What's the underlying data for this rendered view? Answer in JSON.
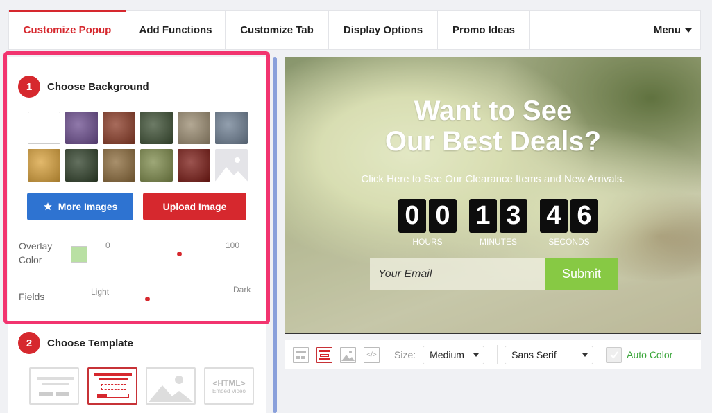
{
  "tabs": [
    {
      "label": "Customize Popup",
      "active": true
    },
    {
      "label": "Add Functions",
      "active": false
    },
    {
      "label": "Customize Tab",
      "active": false
    },
    {
      "label": "Display Options",
      "active": false
    },
    {
      "label": "Promo Ideas",
      "active": false
    }
  ],
  "menu_label": "Menu",
  "step1": {
    "number": "1",
    "title": "Choose Background"
  },
  "background_thumbnails": [
    {
      "name": "blank",
      "color": "#ffffff"
    },
    {
      "name": "purple-flowers",
      "color": "#6b4c8e"
    },
    {
      "name": "red-castle",
      "color": "#8a3a25"
    },
    {
      "name": "forest-path",
      "color": "#3c4f33"
    },
    {
      "name": "cat",
      "color": "#9a8b70"
    },
    {
      "name": "pier",
      "color": "#6e7f93"
    },
    {
      "name": "sunset-yoga",
      "color": "#d9a13a"
    },
    {
      "name": "snowdrops",
      "color": "#2f4029"
    },
    {
      "name": "family-autumn",
      "color": "#8b6a3a"
    },
    {
      "name": "deer",
      "color": "#7d8a4a"
    },
    {
      "name": "red-light",
      "color": "#7a1a14"
    },
    {
      "name": "placeholder",
      "color": "#e4e4e8"
    }
  ],
  "buttons": {
    "more_images": "More Images",
    "upload_image": "Upload Image"
  },
  "overlay": {
    "label_line1": "Overlay",
    "label_line2": "Color",
    "min_label": "0",
    "max_label": "100",
    "swatch_color": "#b9e0a3",
    "value": 50
  },
  "fields": {
    "label": "Fields",
    "light_label": "Light",
    "dark_label": "Dark",
    "value": 35
  },
  "step2": {
    "number": "2",
    "title": "Choose Template"
  },
  "templates": [
    {
      "name": "template-basic",
      "selected": false
    },
    {
      "name": "template-countdown",
      "selected": true
    },
    {
      "name": "template-image",
      "selected": false
    },
    {
      "name": "template-html",
      "selected": false,
      "html_label": "<HTML>",
      "embed_label": "Embed Video"
    }
  ],
  "preview": {
    "title_line1": "Want to See",
    "title_line2": "Our Best Deals?",
    "subtitle": "Click Here to See Our Clearance Items and New Arrivals.",
    "countdown": [
      {
        "digits": [
          "0",
          "0"
        ],
        "label": "HOURS"
      },
      {
        "digits": [
          "1",
          "3"
        ],
        "label": "MINUTES"
      },
      {
        "digits": [
          "4",
          "6"
        ],
        "label": "SECONDS"
      }
    ],
    "email_placeholder": "Your Email",
    "submit_label": "Submit"
  },
  "toolbar": {
    "size_label": "Size:",
    "size_value": "Medium",
    "font_value": "Sans Serif",
    "auto_color_label": "Auto Color"
  },
  "colors": {
    "accent_red": "#d6282e",
    "blue": "#2e73d1",
    "green": "#87c944",
    "highlight": "#f2346f"
  }
}
